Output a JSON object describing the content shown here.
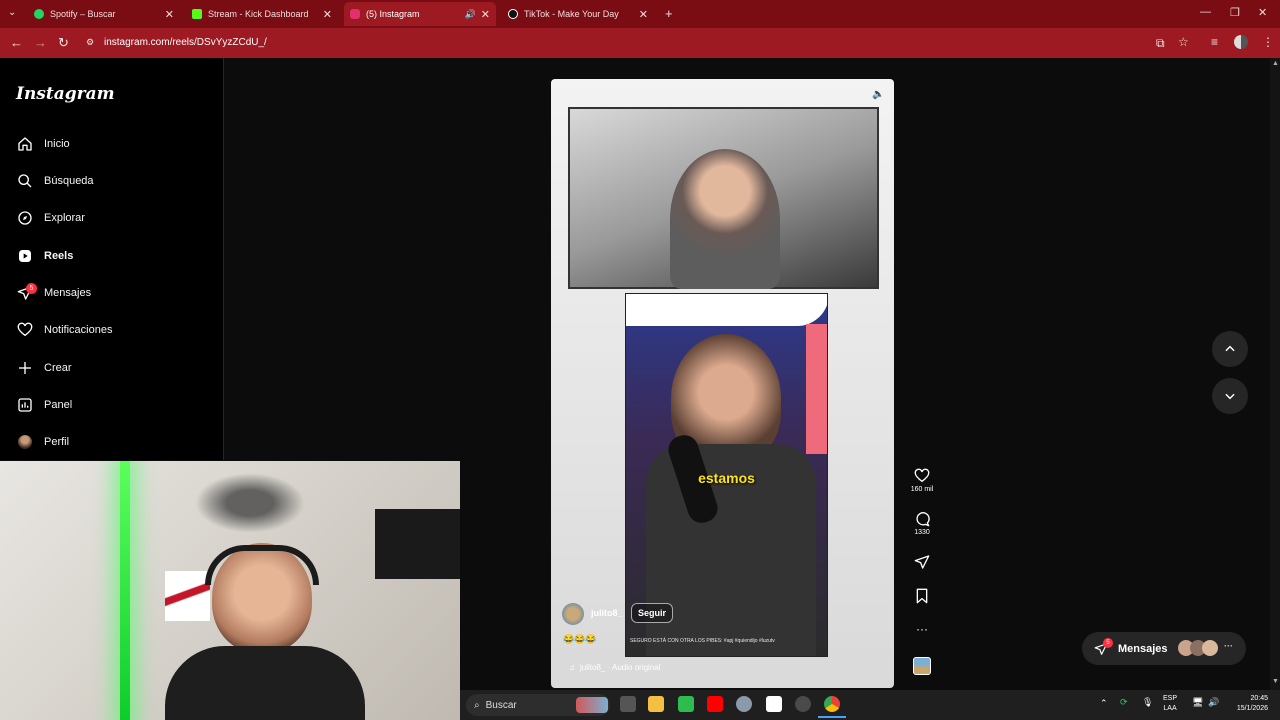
{
  "browser": {
    "tabs": [
      {
        "title": "Spotify – Buscar",
        "color": "#1ed760"
      },
      {
        "title": "Stream - Kick Dashboard",
        "color": "#53fc18"
      },
      {
        "title": "(5) Instagram",
        "color": "#e1306c"
      },
      {
        "title": "TikTok - Make Your Day",
        "color": "#111111"
      }
    ],
    "url": "instagram.com/reels/DSvYyzZCdU_/"
  },
  "instagram": {
    "logo": "Instagram",
    "nav": [
      {
        "label": "Inicio",
        "icon": "home-icon"
      },
      {
        "label": "Búsqueda",
        "icon": "search-icon"
      },
      {
        "label": "Explorar",
        "icon": "compass-icon"
      },
      {
        "label": "Reels",
        "icon": "reels-icon"
      },
      {
        "label": "Mensajes",
        "icon": "messenger-icon"
      },
      {
        "label": "Notificaciones",
        "icon": "heart-icon"
      },
      {
        "label": "Crear",
        "icon": "plus-icon"
      },
      {
        "label": "Panel",
        "icon": "chart-icon"
      },
      {
        "label": "Perfil",
        "icon": "avatar"
      }
    ],
    "messages_badge": "5",
    "reel": {
      "caption_word": "estamos",
      "username": "julito8_",
      "follow_label": "Seguir",
      "description": "SEGURO ESTÁ CON OTRA LOS PIBES: #apj #quiendijo #luzutv",
      "emojis": "😂😂😂",
      "audio": "julito8_ · Audio original",
      "likes": "160 mil",
      "comments": "1330"
    },
    "messages_pill": {
      "label": "Mensajes",
      "badge": "5"
    }
  },
  "taskbar": {
    "search_placeholder": "Buscar",
    "lang_line1": "ESP",
    "lang_line2": "LAA",
    "time": "20:45",
    "date": "15/1/2026"
  }
}
